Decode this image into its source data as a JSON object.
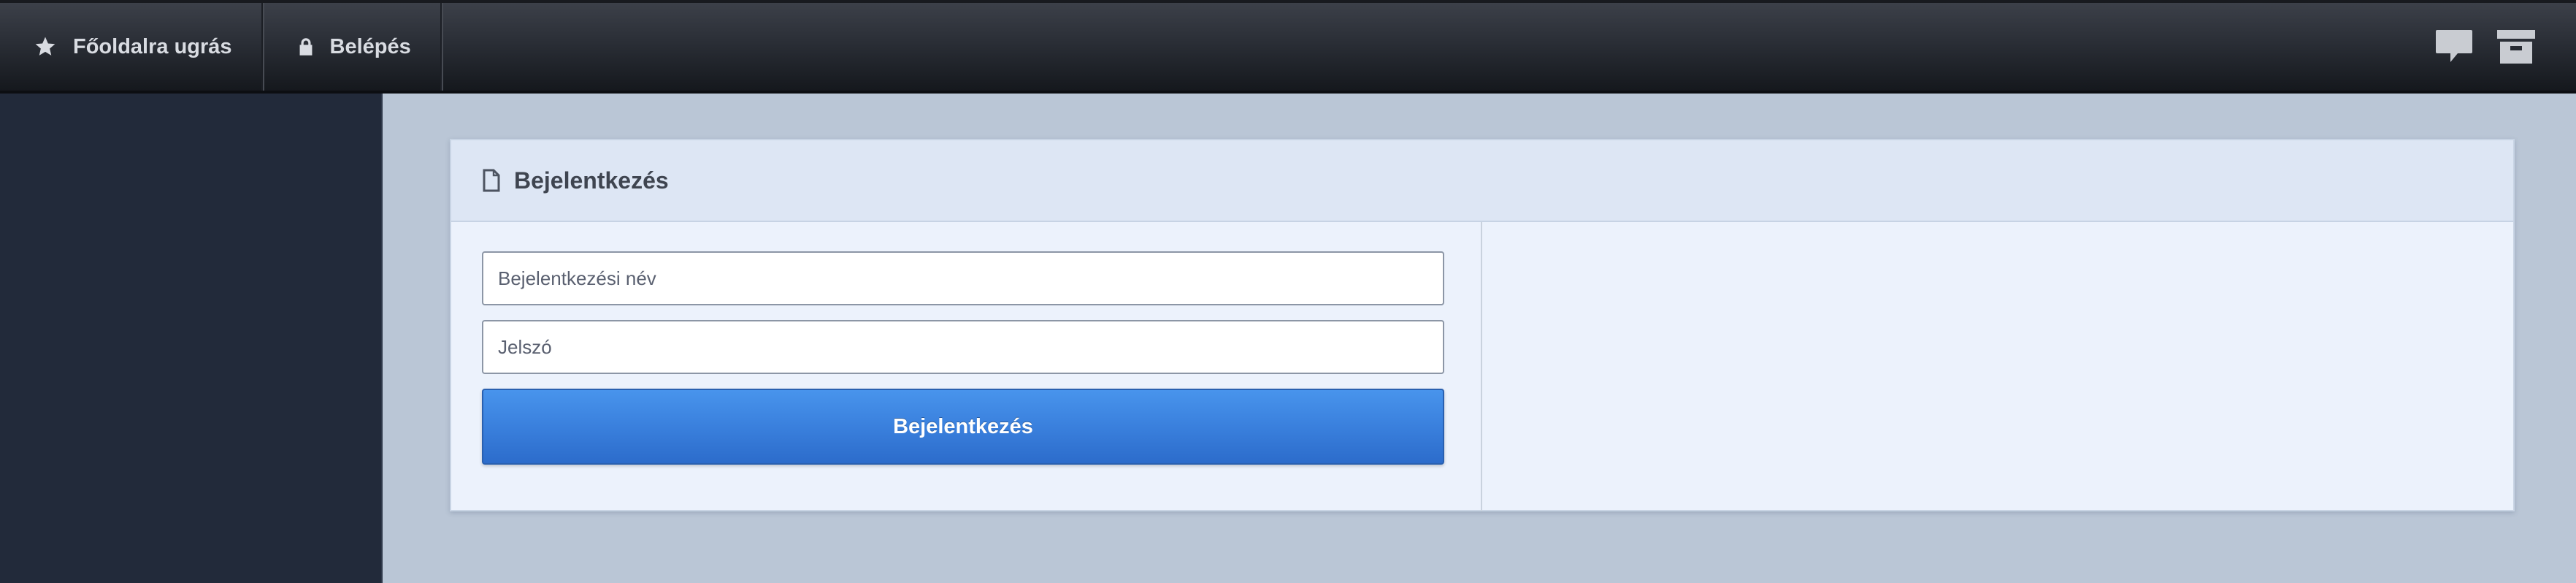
{
  "nav": {
    "home_label": "Főoldalra ugrás",
    "login_label": "Belépés",
    "home_icon": "star-icon",
    "login_icon": "lock-icon",
    "right_icons": [
      "chat-bubble-icon",
      "archive-box-icon"
    ]
  },
  "panel": {
    "title": "Bejelentkezés",
    "title_icon": "document-icon"
  },
  "form": {
    "username_placeholder": "Bejelentkezési név",
    "username_value": "",
    "password_placeholder": "Jelszó",
    "password_value": "",
    "submit_label": "Bejelentkezés"
  },
  "colors": {
    "topbar": "#2a2e36",
    "sidebar": "#222a3a",
    "background": "#bac6d6",
    "panel": "#ecf2fc",
    "button": "#3a80dd"
  }
}
